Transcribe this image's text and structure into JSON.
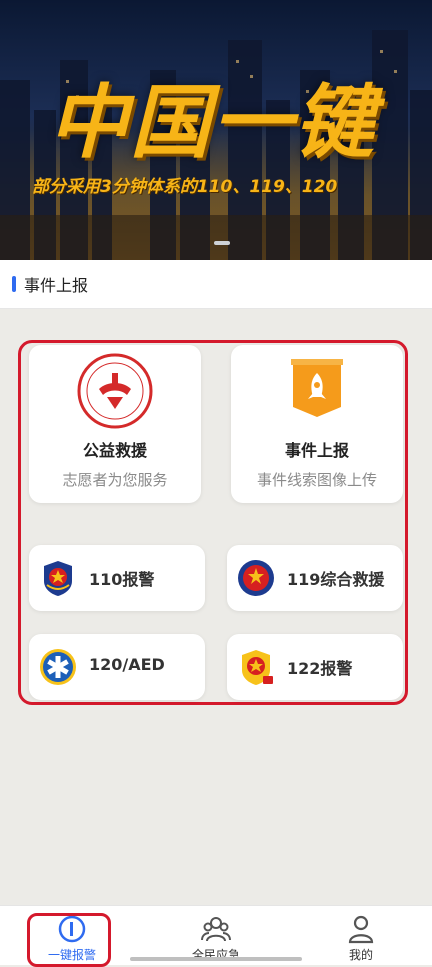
{
  "banner": {
    "title": "中国一键",
    "subtitle": "部分采用3分钟体系的110、119、120",
    "title_color": "#f7b417"
  },
  "section": {
    "title": "事件上报",
    "accent_color": "#2f6bf0"
  },
  "big_cards": [
    {
      "name": "公益救援",
      "desc": "志愿者为您服务",
      "icon": "volunteer-badge-icon"
    },
    {
      "name": "事件上报",
      "desc": "事件线索图像上传",
      "icon": "rocket-ribbon-icon"
    }
  ],
  "small_cards": [
    {
      "name": "110报警",
      "icon": "police-emblem-icon"
    },
    {
      "name": "119综合救援",
      "icon": "fire-rescue-emblem-icon"
    },
    {
      "name": "120/AED",
      "icon": "medical-star-of-life-icon"
    },
    {
      "name": "122报警",
      "icon": "traffic-police-emblem-icon"
    }
  ],
  "highlight_color": "#d4192c",
  "nav": [
    {
      "label": "一键报警",
      "icon": "sos-alarm-icon",
      "active": true
    },
    {
      "label": "全民应急",
      "icon": "people-group-icon",
      "active": false
    },
    {
      "label": "我的",
      "icon": "user-profile-icon",
      "active": false
    }
  ]
}
